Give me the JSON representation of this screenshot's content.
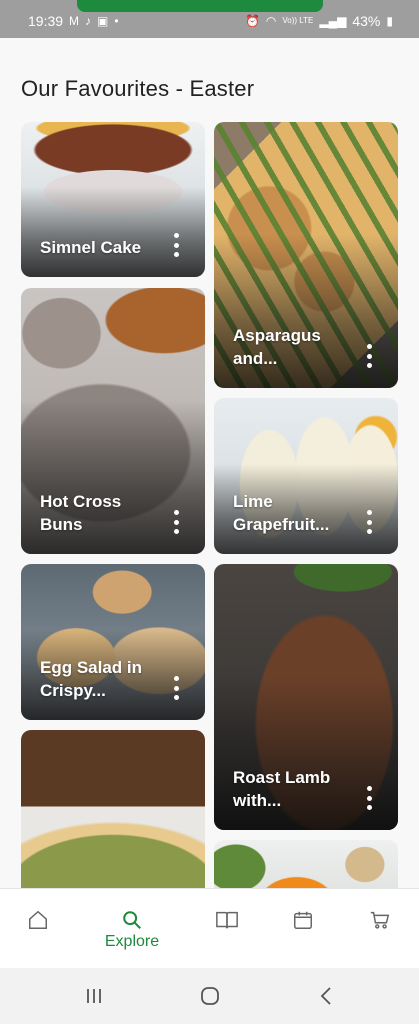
{
  "status_bar": {
    "time": "19:39",
    "battery": "43%",
    "left_icons": [
      "gmail-icon",
      "tiktok-icon",
      "shopping-bag-icon",
      "dot-icon"
    ],
    "right_icons": [
      "alarm-icon",
      "wifi-icon",
      "volte-icon",
      "signal-icon",
      "battery-icon"
    ],
    "volte_text": "Vo)) LTE"
  },
  "section": {
    "title": "Our Favourites - Easter"
  },
  "cards": [
    {
      "title": "Simnel Cake"
    },
    {
      "title": "Asparagus and..."
    },
    {
      "title": "Hot Cross Buns"
    },
    {
      "title": "Lime Grapefruit..."
    },
    {
      "title": "Egg Salad in Crispy..."
    },
    {
      "title": "Roast Lamb with..."
    }
  ],
  "bottom_nav": {
    "active_label": "Explore",
    "items": [
      "home-icon",
      "search-icon",
      "recipe-book-icon",
      "calendar-icon",
      "cart-icon"
    ]
  },
  "colors": {
    "accent": "#1e8a3e"
  }
}
